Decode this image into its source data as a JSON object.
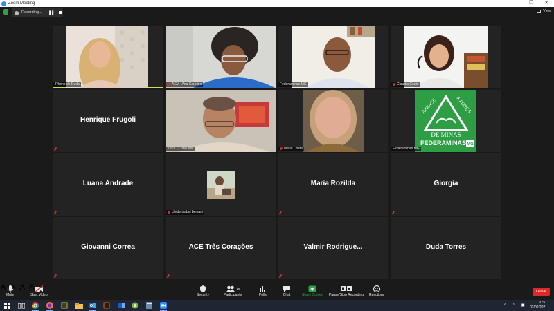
{
  "window": {
    "title": "Zoom Meeting"
  },
  "recording": {
    "label": "Recording..."
  },
  "view": {
    "label": "View"
  },
  "tiles": [
    {
      "id": "duda",
      "label": "iPhone de Duda",
      "video": true
    },
    {
      "id": "ana",
      "label": "ACV - Ana Carolina",
      "video": true,
      "muted": true
    },
    {
      "id": "federaminas1",
      "label": "Federaminas MG",
      "video": true
    },
    {
      "id": "claudia",
      "label": "Claudia Couto",
      "video": true,
      "muted": true
    },
    {
      "id": "henrique",
      "name": "Henrique Frugoli",
      "muted": true
    },
    {
      "id": "zeca",
      "label": "Zeca - Consultor",
      "video": true,
      "muted": true
    },
    {
      "id": "maria-costa",
      "label": "Maria Costa",
      "video": true,
      "muted": true
    },
    {
      "id": "federaminas2",
      "label": "Federaminas MG",
      "video": true
    },
    {
      "id": "luana",
      "name": "Luana Andrade",
      "muted": true
    },
    {
      "id": "cleide",
      "label": "cleide isabel bersani",
      "muted": true
    },
    {
      "id": "rozilda",
      "name": "Maria Rozilda",
      "muted": true
    },
    {
      "id": "giorgia",
      "name": "Giorgia",
      "muted": true
    },
    {
      "id": "giovanni",
      "name": "Giovanni Correa",
      "muted": true
    },
    {
      "id": "ace",
      "name": "ACE Três Corações",
      "muted": true
    },
    {
      "id": "valmir",
      "name": "Valmir  Rodrigue...",
      "muted": true
    },
    {
      "id": "duda-torres",
      "name": "Duda Torres"
    }
  ],
  "logo": {
    "line1": "ABRACE",
    "line2": "A FORÇA",
    "line3": "DE MINAS",
    "brand": "FEDERAMINAS",
    "brand_suffix": "MG",
    "bg_color": "#2e9e45"
  },
  "toolbar": {
    "mute": "Mute",
    "start_video": "Start Video",
    "security": "Security",
    "participants": "Participants",
    "participants_count": "16",
    "polls": "Polls",
    "chat": "Chat",
    "share_screen": "Share Screen",
    "pause_recording": "Pause/Stop Recording",
    "reactions": "Reactions",
    "leave": "Leave",
    "share_color": "#2ea043",
    "leave_color": "#e02828"
  },
  "taskbar": {
    "time": "10:51",
    "date": "02/02/2021",
    "apps": [
      "windows-icon",
      "task-view-icon",
      "chrome-icon",
      "firefox-icon",
      "notepad-icon",
      "file-explorer-icon",
      "outlook-icon",
      "acrobat-icon",
      "word-icon",
      "excel-icon",
      "calculator-icon",
      "zoom-icon"
    ]
  }
}
